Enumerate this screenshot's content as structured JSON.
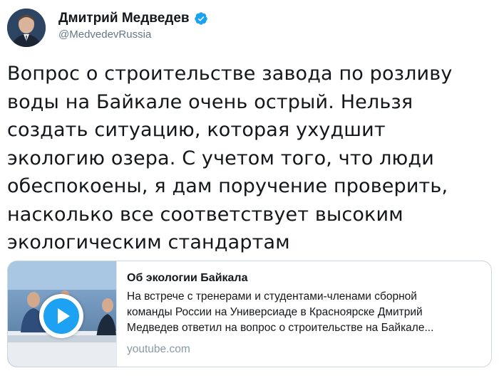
{
  "author": {
    "name": "Дмитрий Медведев",
    "handle": "@MedvedevRussia",
    "verified": true,
    "verified_color": "#1da1f2"
  },
  "tweet": {
    "lines": [
      "Вопрос о строительстве завода по розливу",
      "воды на Байкале очень острый. Нельзя",
      "создать ситуацию, которая ухудшит",
      "экологию озера. С учетом того, что люди",
      "обеспокоены, я дам поручение проверить,",
      "насколько все соответствует высоким",
      "экологическим стандартам"
    ]
  },
  "card": {
    "title": "Об экологии Байкала",
    "description_lines": [
      "На встрече с тренерами и студентами-членами сборной",
      "команды России на Универсиаде в Красноярске Дмитрий",
      "Медведев ответил на вопрос о строительстве на Байкале..."
    ],
    "domain": "youtube.com",
    "thumbnail_icon": "play-icon",
    "accent": "#1da1f2"
  }
}
